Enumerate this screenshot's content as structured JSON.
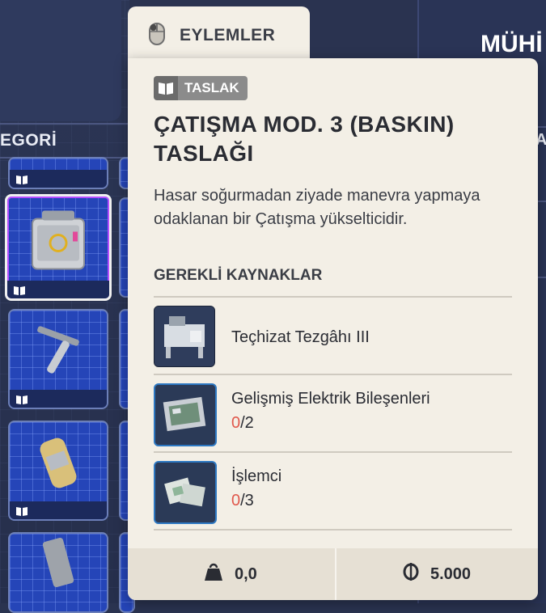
{
  "tab": {
    "label": "EYLEMLER",
    "icon": "mouse-icon"
  },
  "background": {
    "category_label": "EGORİ",
    "right_title": "MÜHİ",
    "right_edge_letter": "A"
  },
  "card": {
    "badge": {
      "label": "TASLAK",
      "icon": "book-icon"
    },
    "title_line1": "ÇATIŞMA MOD. 3 (BASKIN)",
    "title_line2": "TASLAĞI",
    "description": "Hasar soğurmadan ziyade manevra yapmaya odaklanan bir Çatışma yükselticidir.",
    "requirements_header": "GEREKLİ KAYNAKLAR",
    "resources": [
      {
        "name": "Teçhizat Tezgâhı III",
        "icon": "workbench-icon"
      },
      {
        "name": "Gelişmiş Elektrik Bileşenleri",
        "have": "0",
        "need": "/2",
        "icon": "electrical-components-icon"
      },
      {
        "name": "İşlemci",
        "have": "0",
        "need": "/3",
        "icon": "processor-icon"
      }
    ],
    "footer": {
      "weight": "0,0",
      "price": "5.000",
      "weight_icon": "weight-icon",
      "price_icon": "currency-icon"
    }
  },
  "colors": {
    "accent_red": "#e0584c",
    "card_bg": "#f3efe6",
    "tile_blue": "#2545b8"
  }
}
